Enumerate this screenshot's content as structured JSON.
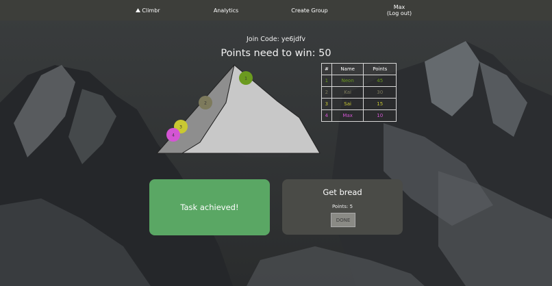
{
  "nav": {
    "brand_icon": "mountain-icon",
    "brand_label": "Climbr",
    "analytics_label": "Analytics",
    "create_group_label": "Create Group",
    "user_name": "Max",
    "logout_label": "(Log out)"
  },
  "game": {
    "join_code": "Join Code: ye6jdfv",
    "points_to_win": "Points need to win: 50"
  },
  "leaderboard": {
    "headers": [
      "#",
      "Name",
      "Points"
    ],
    "rows": [
      {
        "rank": "1",
        "name": "Neon",
        "points": "45",
        "color": "#6b9a1f"
      },
      {
        "rank": "2",
        "name": "Kai",
        "points": "30",
        "color": "#7d7a5c"
      },
      {
        "rank": "3",
        "name": "Sai",
        "points": "15",
        "color": "#c9c832"
      },
      {
        "rank": "4",
        "name": "Max",
        "points": "10",
        "color": "#d455d4"
      }
    ]
  },
  "players_on_mountain": [
    {
      "label": "1",
      "color": "#6b9a1f"
    },
    {
      "label": "2",
      "color": "#7d7a5c"
    },
    {
      "label": "3",
      "color": "#c9c832"
    },
    {
      "label": "4",
      "color": "#d455d4"
    }
  ],
  "cards": {
    "achieved_label": "Task achieved!",
    "task_title": "Get bread",
    "task_points": "Points: 5",
    "done_label": "DONE"
  },
  "colors": {
    "navbar": "#3d3e3a",
    "achieved_card": "#5aa764",
    "task_card": "#4a4b47"
  }
}
